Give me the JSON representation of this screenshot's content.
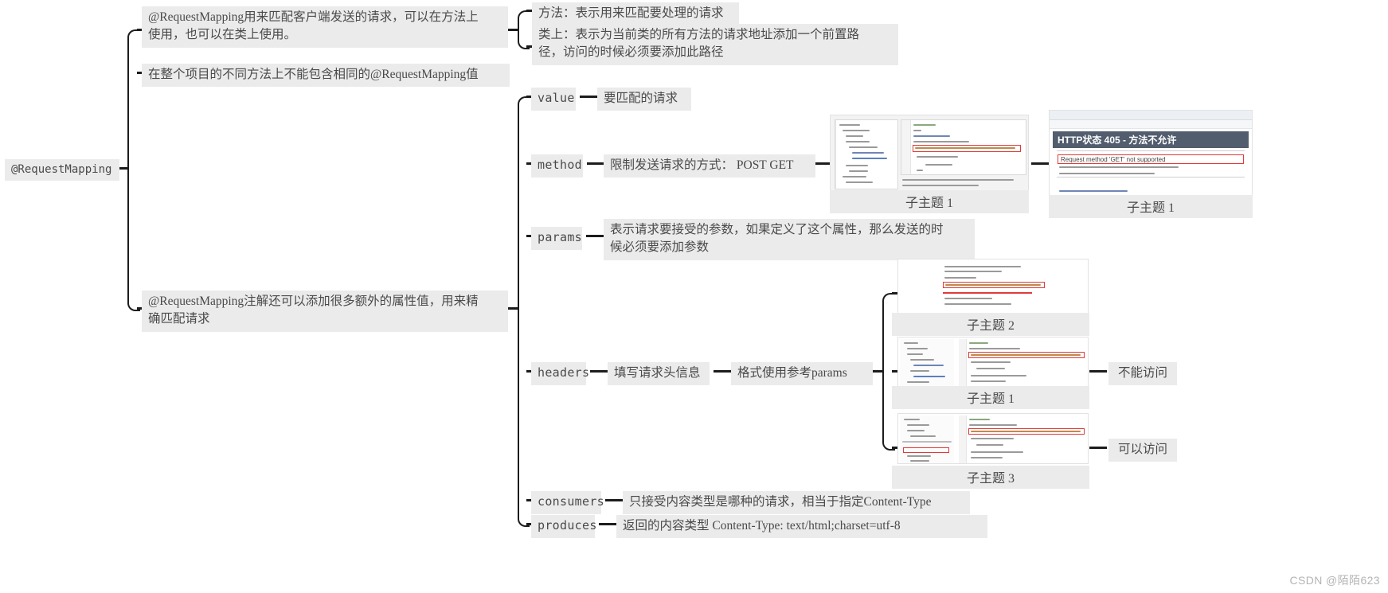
{
  "root": {
    "label": "@RequestMapping"
  },
  "level1": [
    {
      "id": "desc",
      "label": "@RequestMapping用来匹配客户端发送的请求，可以在方法上\n使用，也可以在类上使用。"
    },
    {
      "id": "unique",
      "label": "在整个项目的不同方法上不能包含相同的@RequestMapping值"
    },
    {
      "id": "attrs",
      "label": "@RequestMapping注解还可以添加很多额外的属性值，用来精\n确匹配请求"
    }
  ],
  "usage_notes": [
    {
      "id": "on-method",
      "label": "方法：表示用来匹配要处理的请求"
    },
    {
      "id": "on-class",
      "label": "类上：表示为当前类的所有方法的请求地址添加一个前置路\n径，访问的时候必须要添加此路径"
    }
  ],
  "attributes": [
    {
      "id": "value",
      "name": "value",
      "desc": "要匹配的请求"
    },
    {
      "id": "method",
      "name": "method",
      "desc": "限制发送请求的方式： POST GET"
    },
    {
      "id": "params",
      "name": "params",
      "desc": "表示请求要接受的参数，如果定义了这个属性，那么发送的时\n候必须要添加参数"
    },
    {
      "id": "headers",
      "name": "headers",
      "desc": "填写请求头信息",
      "desc2": "格式使用参考params"
    },
    {
      "id": "consumers",
      "name": "consumers",
      "desc": "只接受内容类型是哪种的请求，相当于指定Content-Type"
    },
    {
      "id": "produces",
      "name": "produces",
      "desc": "返回的内容类型 Content-Type: text/html;charset=utf-8"
    }
  ],
  "method_shots": [
    {
      "id": "shot-method-ide",
      "caption": "子主题 1"
    },
    {
      "id": "shot-method-tomcat",
      "caption": "子主题 1",
      "tomcat_title": "HTTP状态 405 - 方法不允许",
      "tomcat_line": "Request method 'GET' not supported"
    }
  ],
  "headers_shots": [
    {
      "id": "shot-headers-1",
      "caption": "子主题 2",
      "result": null
    },
    {
      "id": "shot-headers-2",
      "caption": "子主题 1",
      "result": "不能访问"
    },
    {
      "id": "shot-headers-3",
      "caption": "子主题 3",
      "result": "可以访问"
    }
  ],
  "watermark": "CSDN @陌陌623",
  "colors": {
    "node_bg": "#ebebeb",
    "text": "#4a4a4a",
    "line": "#1c1c1c",
    "accent_red": "#e03a3a",
    "tomcat_header": "#525d6e"
  }
}
